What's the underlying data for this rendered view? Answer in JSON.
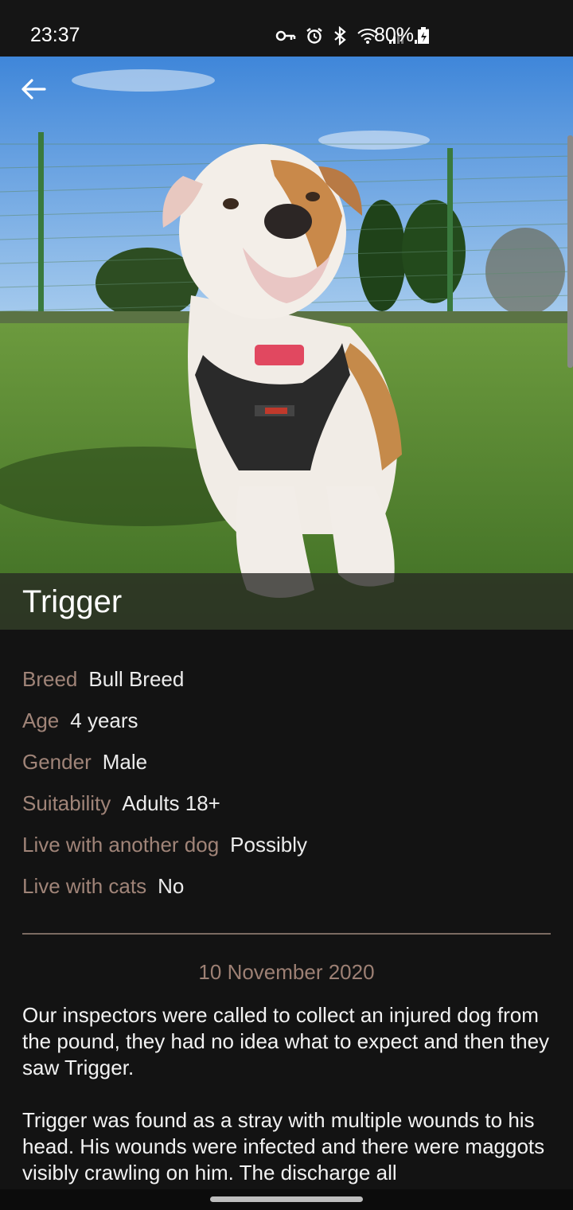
{
  "status_bar": {
    "time": "23:37",
    "battery": "80%",
    "icons": [
      "key-icon",
      "alarm-icon",
      "bluetooth-icon",
      "wifi-icon",
      "signal-icon",
      "signal-icon",
      "battery-icon"
    ]
  },
  "header": {
    "back_icon": "arrow-left-icon"
  },
  "pet": {
    "name": "Trigger",
    "photo": "dog-photo"
  },
  "details": [
    {
      "label": "Breed",
      "value": "Bull Breed"
    },
    {
      "label": "Age",
      "value": "4 years"
    },
    {
      "label": "Gender",
      "value": "Male"
    },
    {
      "label": "Suitability",
      "value": "Adults 18+"
    },
    {
      "label": "Live with another dog",
      "value": "Possibly"
    },
    {
      "label": "Live with cats",
      "value": "No"
    }
  ],
  "story": {
    "date": "10 November 2020",
    "paragraphs": [
      "Our inspectors were called to collect an injured dog from the pound, they had no idea what to expect and then they saw Trigger.",
      "Trigger was found as a stray with multiple wounds to his head. His wounds were infected and there were maggots visibly crawling on him. The discharge all"
    ]
  },
  "colors": {
    "background": "#131313",
    "label": "#a08478",
    "accent_divider": "#7b6b62"
  }
}
